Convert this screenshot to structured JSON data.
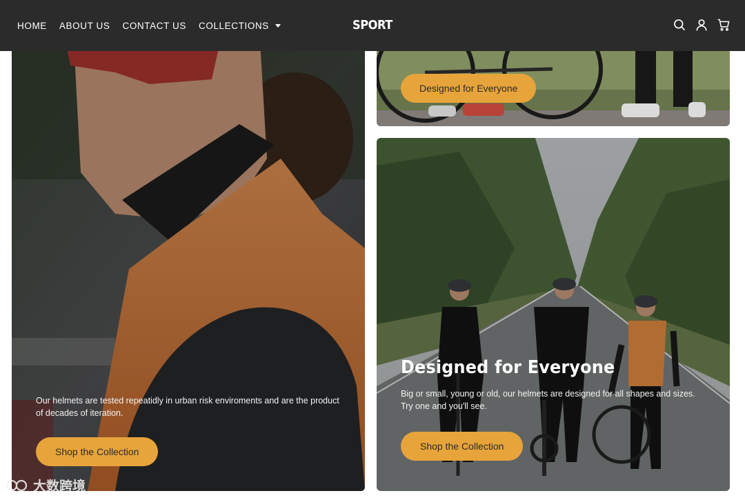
{
  "nav": {
    "home": "HOME",
    "about": "ABOUT US",
    "contact": "CONTACT US",
    "collections": "COLLECTIONS"
  },
  "brand": {
    "logo": "SPORT"
  },
  "header_icons": [
    "search-icon",
    "account-icon",
    "cart-icon"
  ],
  "colors": {
    "header_bg": "#2b2b2b",
    "accent": "#e7a43a",
    "button_text": "#2b2b2b"
  },
  "cards": {
    "left": {
      "text": "Our helmets are tested repeatidly in urban risk enviroments and are the product of decades of iteration.",
      "button": "Shop the Collection"
    },
    "top_right": {
      "button": "Designed for Everyone"
    },
    "bottom_right": {
      "title": "Designed for Everyone",
      "text": "Big or small, young or old, our helmets are designed for all shapes and sizes. Try one and you'll see.",
      "button": "Shop the Collection"
    }
  },
  "watermark": "大数跨境"
}
